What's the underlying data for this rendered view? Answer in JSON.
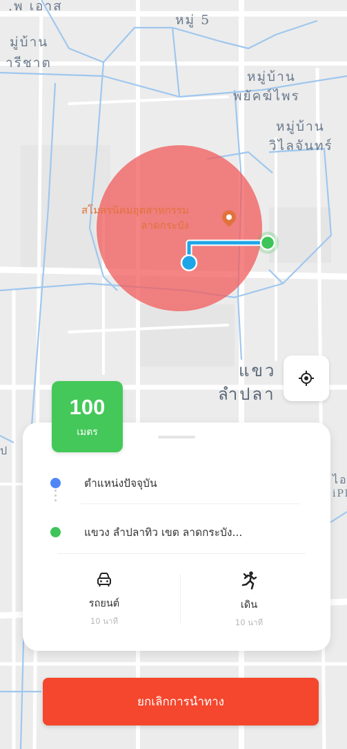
{
  "map": {
    "labels": {
      "top_left": ".พ เอาส",
      "moo5": "หมู่ 5",
      "village_left_1": "มู่บ้าน",
      "village_left_2": "ารีชาต",
      "village_pa_1": "หมู่บ้าน",
      "village_pa_2": "พยัคฆ์ไพร",
      "village_wilai_1": "หมู่บ้าน",
      "village_wilai_2": "วิไลจันทร์",
      "khwaeng_1": "แขว",
      "khwaeng_2": "ลำปลา",
      "edge_right_1": "ไอเ",
      "edge_right_2": "iPla",
      "edge_left": "ป"
    },
    "poi": {
      "name_line1": "สโมสรนิคมอุตสาหกรรม",
      "name_line2": "ลาดกระบัง"
    },
    "colors": {
      "radius_circle": "#f15b5b",
      "route": "#1ea5e8",
      "origin": "#1ea5e8",
      "destination": "#3ec458"
    }
  },
  "locate_button": {
    "icon": "target-icon"
  },
  "distance": {
    "value": "100",
    "unit": "เมตร",
    "color": "#45c85a"
  },
  "route_card": {
    "origin": {
      "label": "ตำแหน่งปัจจุบัน",
      "dot_color": "#4f86f7"
    },
    "destination": {
      "label": "แขวง ลำปลาทิว เขต ลาดกระบัง...",
      "dot_color": "#3ec458"
    },
    "modes": [
      {
        "icon": "car-icon",
        "label": "รถยนต์",
        "time": "10 นาที"
      },
      {
        "icon": "walk-icon",
        "label": "เดิน",
        "time": "10 นาที"
      }
    ]
  },
  "cancel_button": {
    "label": "ยกเลิกการนำทาง",
    "color": "#f4472d"
  }
}
